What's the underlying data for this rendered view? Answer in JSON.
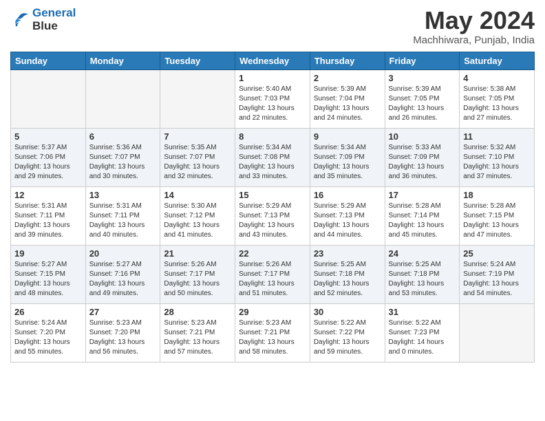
{
  "header": {
    "logo_line1": "General",
    "logo_line2": "Blue",
    "month_title": "May 2024",
    "location": "Machhiwara, Punjab, India"
  },
  "weekdays": [
    "Sunday",
    "Monday",
    "Tuesday",
    "Wednesday",
    "Thursday",
    "Friday",
    "Saturday"
  ],
  "weeks": [
    [
      {
        "day": "",
        "sunrise": "",
        "sunset": "",
        "daylight": ""
      },
      {
        "day": "",
        "sunrise": "",
        "sunset": "",
        "daylight": ""
      },
      {
        "day": "",
        "sunrise": "",
        "sunset": "",
        "daylight": ""
      },
      {
        "day": "1",
        "sunrise": "Sunrise: 5:40 AM",
        "sunset": "Sunset: 7:03 PM",
        "daylight": "Daylight: 13 hours and 22 minutes."
      },
      {
        "day": "2",
        "sunrise": "Sunrise: 5:39 AM",
        "sunset": "Sunset: 7:04 PM",
        "daylight": "Daylight: 13 hours and 24 minutes."
      },
      {
        "day": "3",
        "sunrise": "Sunrise: 5:39 AM",
        "sunset": "Sunset: 7:05 PM",
        "daylight": "Daylight: 13 hours and 26 minutes."
      },
      {
        "day": "4",
        "sunrise": "Sunrise: 5:38 AM",
        "sunset": "Sunset: 7:05 PM",
        "daylight": "Daylight: 13 hours and 27 minutes."
      }
    ],
    [
      {
        "day": "5",
        "sunrise": "Sunrise: 5:37 AM",
        "sunset": "Sunset: 7:06 PM",
        "daylight": "Daylight: 13 hours and 29 minutes."
      },
      {
        "day": "6",
        "sunrise": "Sunrise: 5:36 AM",
        "sunset": "Sunset: 7:07 PM",
        "daylight": "Daylight: 13 hours and 30 minutes."
      },
      {
        "day": "7",
        "sunrise": "Sunrise: 5:35 AM",
        "sunset": "Sunset: 7:07 PM",
        "daylight": "Daylight: 13 hours and 32 minutes."
      },
      {
        "day": "8",
        "sunrise": "Sunrise: 5:34 AM",
        "sunset": "Sunset: 7:08 PM",
        "daylight": "Daylight: 13 hours and 33 minutes."
      },
      {
        "day": "9",
        "sunrise": "Sunrise: 5:34 AM",
        "sunset": "Sunset: 7:09 PM",
        "daylight": "Daylight: 13 hours and 35 minutes."
      },
      {
        "day": "10",
        "sunrise": "Sunrise: 5:33 AM",
        "sunset": "Sunset: 7:09 PM",
        "daylight": "Daylight: 13 hours and 36 minutes."
      },
      {
        "day": "11",
        "sunrise": "Sunrise: 5:32 AM",
        "sunset": "Sunset: 7:10 PM",
        "daylight": "Daylight: 13 hours and 37 minutes."
      }
    ],
    [
      {
        "day": "12",
        "sunrise": "Sunrise: 5:31 AM",
        "sunset": "Sunset: 7:11 PM",
        "daylight": "Daylight: 13 hours and 39 minutes."
      },
      {
        "day": "13",
        "sunrise": "Sunrise: 5:31 AM",
        "sunset": "Sunset: 7:11 PM",
        "daylight": "Daylight: 13 hours and 40 minutes."
      },
      {
        "day": "14",
        "sunrise": "Sunrise: 5:30 AM",
        "sunset": "Sunset: 7:12 PM",
        "daylight": "Daylight: 13 hours and 41 minutes."
      },
      {
        "day": "15",
        "sunrise": "Sunrise: 5:29 AM",
        "sunset": "Sunset: 7:13 PM",
        "daylight": "Daylight: 13 hours and 43 minutes."
      },
      {
        "day": "16",
        "sunrise": "Sunrise: 5:29 AM",
        "sunset": "Sunset: 7:13 PM",
        "daylight": "Daylight: 13 hours and 44 minutes."
      },
      {
        "day": "17",
        "sunrise": "Sunrise: 5:28 AM",
        "sunset": "Sunset: 7:14 PM",
        "daylight": "Daylight: 13 hours and 45 minutes."
      },
      {
        "day": "18",
        "sunrise": "Sunrise: 5:28 AM",
        "sunset": "Sunset: 7:15 PM",
        "daylight": "Daylight: 13 hours and 47 minutes."
      }
    ],
    [
      {
        "day": "19",
        "sunrise": "Sunrise: 5:27 AM",
        "sunset": "Sunset: 7:15 PM",
        "daylight": "Daylight: 13 hours and 48 minutes."
      },
      {
        "day": "20",
        "sunrise": "Sunrise: 5:27 AM",
        "sunset": "Sunset: 7:16 PM",
        "daylight": "Daylight: 13 hours and 49 minutes."
      },
      {
        "day": "21",
        "sunrise": "Sunrise: 5:26 AM",
        "sunset": "Sunset: 7:17 PM",
        "daylight": "Daylight: 13 hours and 50 minutes."
      },
      {
        "day": "22",
        "sunrise": "Sunrise: 5:26 AM",
        "sunset": "Sunset: 7:17 PM",
        "daylight": "Daylight: 13 hours and 51 minutes."
      },
      {
        "day": "23",
        "sunrise": "Sunrise: 5:25 AM",
        "sunset": "Sunset: 7:18 PM",
        "daylight": "Daylight: 13 hours and 52 minutes."
      },
      {
        "day": "24",
        "sunrise": "Sunrise: 5:25 AM",
        "sunset": "Sunset: 7:18 PM",
        "daylight": "Daylight: 13 hours and 53 minutes."
      },
      {
        "day": "25",
        "sunrise": "Sunrise: 5:24 AM",
        "sunset": "Sunset: 7:19 PM",
        "daylight": "Daylight: 13 hours and 54 minutes."
      }
    ],
    [
      {
        "day": "26",
        "sunrise": "Sunrise: 5:24 AM",
        "sunset": "Sunset: 7:20 PM",
        "daylight": "Daylight: 13 hours and 55 minutes."
      },
      {
        "day": "27",
        "sunrise": "Sunrise: 5:23 AM",
        "sunset": "Sunset: 7:20 PM",
        "daylight": "Daylight: 13 hours and 56 minutes."
      },
      {
        "day": "28",
        "sunrise": "Sunrise: 5:23 AM",
        "sunset": "Sunset: 7:21 PM",
        "daylight": "Daylight: 13 hours and 57 minutes."
      },
      {
        "day": "29",
        "sunrise": "Sunrise: 5:23 AM",
        "sunset": "Sunset: 7:21 PM",
        "daylight": "Daylight: 13 hours and 58 minutes."
      },
      {
        "day": "30",
        "sunrise": "Sunrise: 5:22 AM",
        "sunset": "Sunset: 7:22 PM",
        "daylight": "Daylight: 13 hours and 59 minutes."
      },
      {
        "day": "31",
        "sunrise": "Sunrise: 5:22 AM",
        "sunset": "Sunset: 7:23 PM",
        "daylight": "Daylight: 14 hours and 0 minutes."
      },
      {
        "day": "",
        "sunrise": "",
        "sunset": "",
        "daylight": ""
      }
    ]
  ]
}
